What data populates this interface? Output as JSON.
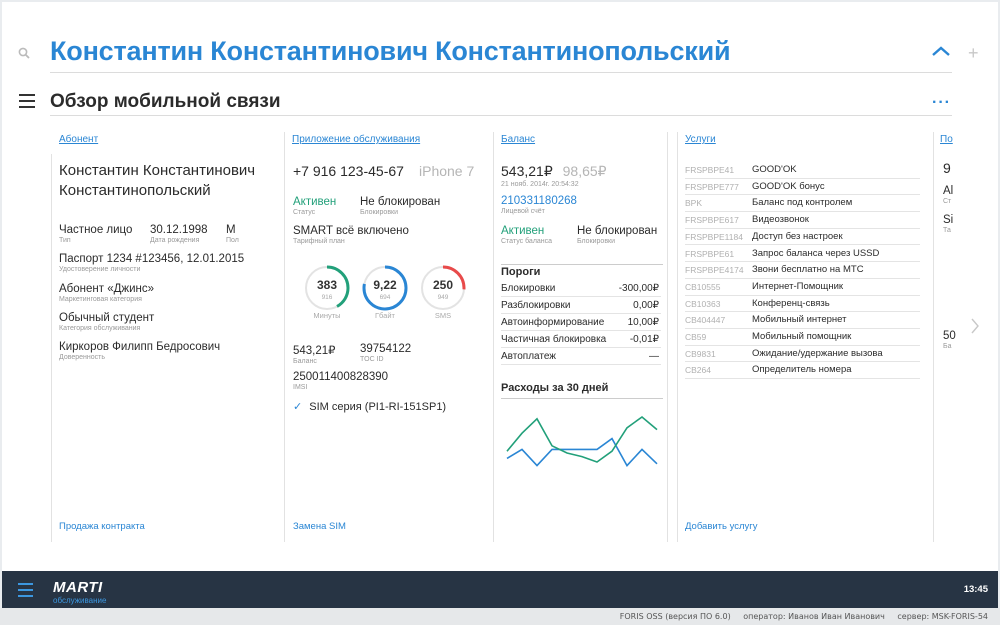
{
  "header": {
    "customer_name": "Константин Константинович Константинопольский"
  },
  "section": {
    "title": "Обзор мобильной связи"
  },
  "columns": {
    "subscriber_head": "Абонент",
    "app_head": "Приложение обслуживания",
    "balance_head": "Баланс",
    "services_head": "Услуги",
    "extra_head": "По"
  },
  "subscriber": {
    "name_line1": "Константин Константинович",
    "name_line2": "Константинопольский",
    "type_value": "Частное лицо",
    "type_label": "Тип",
    "dob_value": "30.12.1998",
    "dob_label": "Дата рождения",
    "sex_value": "М",
    "sex_label": "Пол",
    "doc_value": "Паспорт 1234 #123456, 12.01.2015",
    "doc_label": "Удостоверение личности",
    "mcat_value": "Абонент «Джинс»",
    "mcat_label": "Маркетинговая категория",
    "scat_value": "Обычный студент",
    "scat_label": "Категория обслуживания",
    "proxy_value": "Киркоров Филипп Бедросович",
    "proxy_label": "Доверенность",
    "footer_link": "Продажа контракта"
  },
  "app": {
    "phone": "+7 916 123-45-67",
    "device": "iPhone 7",
    "status_value": "Активен",
    "status_label": "Статус",
    "block_value": "Не блокирован",
    "block_label": "Блокировки",
    "tariff_value": "SMART всё включено",
    "tariff_label": "Тарифный план",
    "gauges": [
      {
        "value": "383",
        "sub": "916",
        "caption": "Минуты",
        "fraction": 0.42,
        "color": "#22a07a"
      },
      {
        "value": "9,22",
        "sub": "694",
        "caption": "Гбайт",
        "fraction": 0.78,
        "color": "#2a86d4"
      },
      {
        "value": "250",
        "sub": "949",
        "caption": "SMS",
        "fraction": 0.26,
        "color": "#e84a4a"
      }
    ],
    "balance_value": "543,21₽",
    "balance_label": "Баланс",
    "toc_value": "39754122",
    "toc_label": "TOC ID",
    "imsi_value": "250011400828390",
    "imsi_label": "IMSI",
    "sim_check": "✓",
    "sim_value": "SIM серия (PI1-RI-151SP1)",
    "footer_link": "Замена SIM"
  },
  "balance": {
    "main": "543,21₽",
    "secondary": "98,65₽",
    "date": "21 нояб. 2014г. 20:54:32",
    "account_value": "210331180268",
    "account_label": "Лицевой счёт",
    "status_value": "Активен",
    "status_label": "Статус баланса",
    "block_value": "Не блокирован",
    "block_label": "Блокировки",
    "thresholds_title": "Пороги",
    "thresholds": [
      {
        "label": "Блокировки",
        "value": "-300,00₽"
      },
      {
        "label": "Разблокировки",
        "value": "0,00₽"
      },
      {
        "label": "Автоинформирование",
        "value": "10,00₽"
      },
      {
        "label": "Частичная блокировка",
        "value": "-0,01₽"
      },
      {
        "label": "Автоплатеж",
        "value": "—"
      }
    ],
    "spend_title": "Расходы за 30 дней"
  },
  "chart_data": {
    "type": "line",
    "x": [
      1,
      2,
      3,
      4,
      5,
      6,
      7,
      8,
      9,
      10,
      11
    ],
    "series": [
      {
        "values": [
          42,
          47,
          38,
          47,
          47,
          47,
          47,
          53,
          38,
          47,
          39
        ],
        "color": "#2a86d4"
      },
      {
        "values": [
          46,
          56,
          64,
          49,
          45,
          43,
          40,
          46,
          59,
          65,
          58
        ],
        "color": "#22a07a"
      }
    ],
    "ylim": [
      30,
      70
    ],
    "title": "",
    "xlabel": "",
    "ylabel": ""
  },
  "services": {
    "items": [
      {
        "code": "FRSPBPE41",
        "name": "GOOD'OK"
      },
      {
        "code": "FRSPBPE777",
        "name": "GOOD'OK бонус"
      },
      {
        "code": "BPK",
        "name": "Баланс под контролем"
      },
      {
        "code": "FRSPBPE617",
        "name": "Видеозвонок"
      },
      {
        "code": "FRSPBPE1184",
        "name": "Доступ без настроек"
      },
      {
        "code": "FRSPBPE61",
        "name": "Запрос баланса через USSD"
      },
      {
        "code": "FRSPBPE4174",
        "name": "Звони бесплатно на МТС"
      },
      {
        "code": "CB10555",
        "name": "Интернет-Помощник"
      },
      {
        "code": "CB10363",
        "name": "Конференц-связь"
      },
      {
        "code": "CB404447",
        "name": "Мобильный интернет"
      },
      {
        "code": "CB59",
        "name": "Мобильный помощник"
      },
      {
        "code": "CB9831",
        "name": "Ожидание/удержание вызова"
      },
      {
        "code": "CB264",
        "name": "Определитель номера"
      }
    ],
    "footer_link": "Добавить услугу"
  },
  "extra": {
    "v1": "9",
    "v2": "Al",
    "c2": "Ст",
    "v3": "Si",
    "c3": "Та",
    "v4": "50",
    "c4": "Ба"
  },
  "footer": {
    "brand": "MARTI",
    "sub": "обслуживание",
    "time": "13:45"
  },
  "statusbar": {
    "product": "FORIS OSS (версия ПО 6.0)",
    "operator": "оператор: Иванов Иван Иванович",
    "server": "сервер: MSK-FORIS-54"
  }
}
